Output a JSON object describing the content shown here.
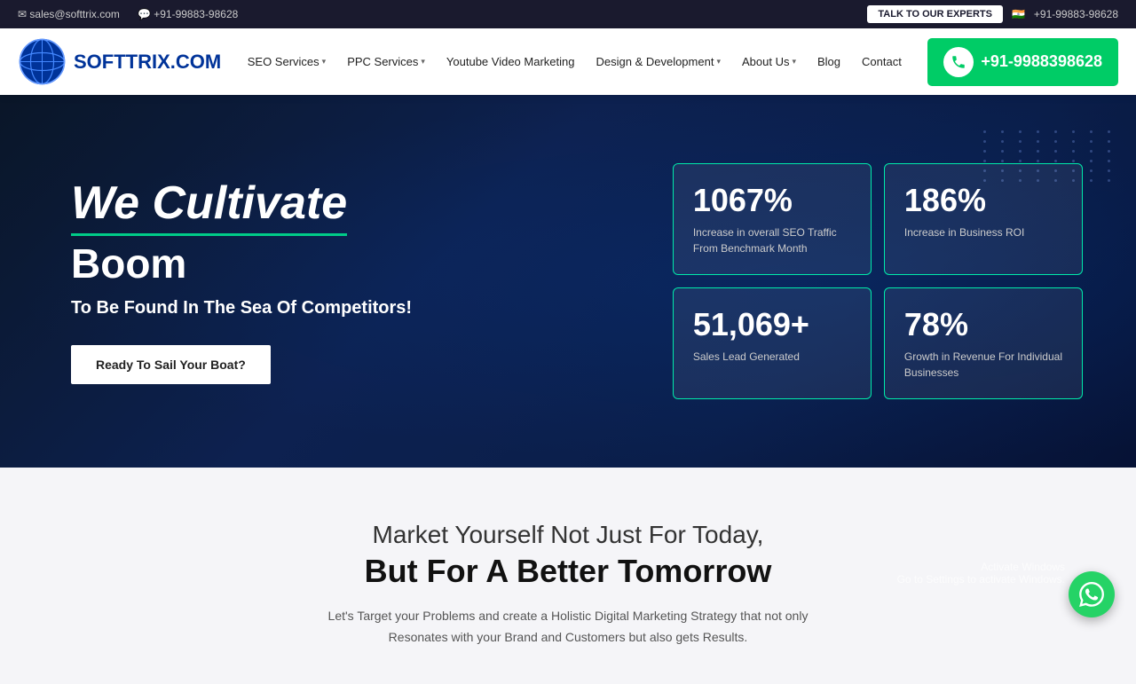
{
  "topbar": {
    "email": "sales@softtrix.com",
    "phone": "+91-99883-98628",
    "talk_btn": "TALK TO OUR EXPERTS",
    "flag": "🇮🇳",
    "right_phone": "+91-99883-98628"
  },
  "navbar": {
    "logo_text": "SOFTTRIX.COM",
    "links": [
      {
        "label": "SEO Services",
        "has_dropdown": true
      },
      {
        "label": "PPC Services",
        "has_dropdown": true
      },
      {
        "label": "Youtube Video Marketing",
        "has_dropdown": false
      },
      {
        "label": "Design & Development",
        "has_dropdown": true
      },
      {
        "label": "About Us",
        "has_dropdown": true
      },
      {
        "label": "Blog",
        "has_dropdown": false
      },
      {
        "label": "Contact",
        "has_dropdown": false
      }
    ],
    "cta_phone": "+91-9988398628"
  },
  "hero": {
    "title_line1": "We Cultivate",
    "title_line2": "Boom",
    "subtitle": "To Be Found In The Sea Of Competitors!",
    "cta_btn": "Ready To Sail Your Boat?",
    "stats": [
      {
        "number": "1067%",
        "label_line1": "Increase in overall SEO Traffic",
        "label_line2": "From Benchmark Month"
      },
      {
        "number": "186%",
        "label_line1": "Increase in Business ROI",
        "label_line2": ""
      },
      {
        "number": "51,069+",
        "label_line1": "Sales Lead Generated",
        "label_line2": ""
      },
      {
        "number": "78%",
        "label_line1": "Growth in Revenue For Individual",
        "label_line2": "Businesses"
      }
    ]
  },
  "below_hero": {
    "title_light": "Market Yourself Not Just For Today,",
    "title_bold": "But For A Better Tomorrow",
    "description": "Let's Target your Problems and create a Holistic Digital Marketing Strategy that not only Resonates with your Brand and Customers but also gets Results."
  },
  "activate_windows": {
    "line1": "Activate Windows",
    "line2": "Go to Settings to activate Windows."
  },
  "colors": {
    "accent_green": "#00cc88",
    "nav_blue": "#003399",
    "cta_green": "#00cc66"
  }
}
